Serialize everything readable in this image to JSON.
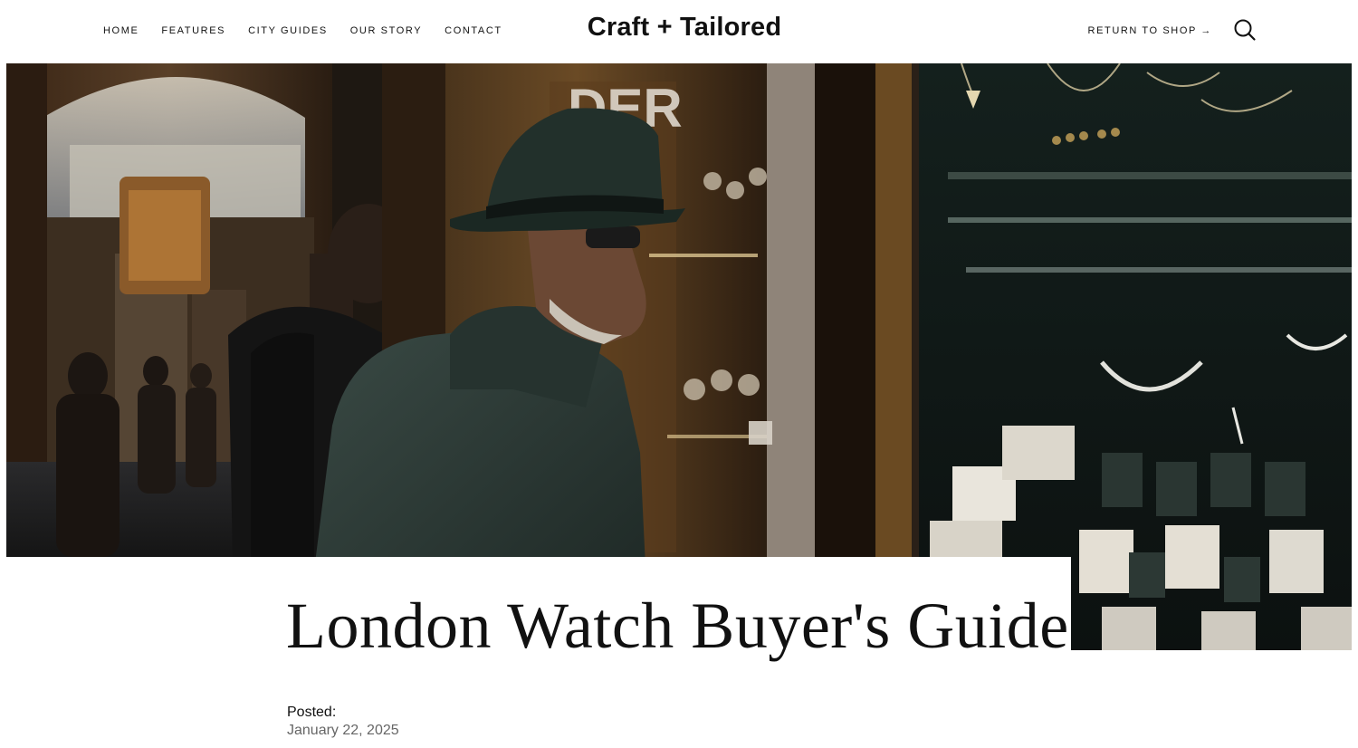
{
  "nav": {
    "items": [
      {
        "label": "HOME"
      },
      {
        "label": "FEATURES"
      },
      {
        "label": "CITY GUIDES"
      },
      {
        "label": "OUR STORY"
      },
      {
        "label": "CONTACT"
      }
    ],
    "logo": "Craft + Tailored",
    "return_label": "RETURN TO SHOP →",
    "search_icon": "search-icon"
  },
  "hero": {
    "image": "man-in-hat-viewing-jewelry-shop-window"
  },
  "article": {
    "title": "London Watch Buyer's Guide",
    "posted_label": "Posted:",
    "posted_date": "January 22, 2025"
  },
  "colors": {
    "text": "#111111",
    "muted": "#666666",
    "background": "#ffffff"
  }
}
